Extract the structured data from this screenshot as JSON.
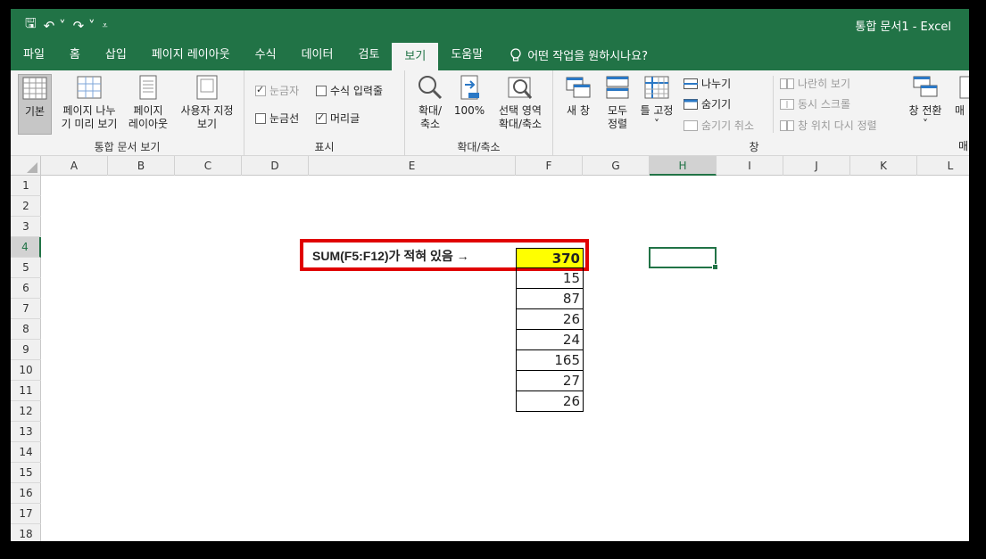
{
  "titlebar": {
    "qat_save": "🖫",
    "qat_undo": "↶ ˅",
    "qat_redo": "↷ ˅",
    "qat_more": "⩡",
    "title": "통합 문서1  -  Excel"
  },
  "tabs": [
    "파일",
    "홈",
    "삽입",
    "페이지 레이아웃",
    "수식",
    "데이터",
    "검토",
    "보기",
    "도움말"
  ],
  "tell_me": "어떤 작업을 원하시나요?",
  "ribbon": {
    "workbook_views": {
      "label": "통합 문서 보기",
      "normal": "기본",
      "page_break": "페이지 나누\n기 미리 보기",
      "page_layout": "페이지\n레이아웃",
      "custom_views": "사용자 지정\n보기"
    },
    "show": {
      "label": "표시",
      "ruler": "눈금자",
      "formula_bar": "수식 입력줄",
      "gridlines": "눈금선",
      "headings": "머리글"
    },
    "zoom": {
      "label": "확대/축소",
      "zoom": "확대/\n축소",
      "hundred": "100%",
      "zoom_selection": "선택 영역\n확대/축소"
    },
    "window": {
      "label": "창",
      "new_window": "새 창",
      "arrange_all": "모두\n정렬",
      "freeze_panes": "틀 고정\n˅",
      "split": "나누기",
      "hide": "숨기기",
      "unhide": "숨기기 취소",
      "side_by_side": "나란히 보기",
      "sync_scroll": "동시 스크롤",
      "reset_position": "창 위치 다시 정렬",
      "switch_windows": "창 전환\n˅",
      "macros": "매",
      "macros_label": "매"
    }
  },
  "columns": [
    "A",
    "B",
    "C",
    "D",
    "E",
    "F",
    "G",
    "H",
    "I",
    "J",
    "K",
    "L"
  ],
  "rows": [
    "1",
    "2",
    "3",
    "4",
    "5",
    "6",
    "7",
    "8",
    "9",
    "10",
    "11",
    "12",
    "13",
    "14",
    "15",
    "16",
    "17",
    "18"
  ],
  "sheet": {
    "sum_label": "SUM(F5:F12)가 적혀 있음 →",
    "sum_value": "370",
    "values": [
      "15",
      "87",
      "26",
      "24",
      "165",
      "27",
      "26"
    ]
  },
  "colors": {
    "excel_green": "#217346",
    "highlight_yellow": "#ffff00",
    "annotation_red": "#e00000"
  }
}
